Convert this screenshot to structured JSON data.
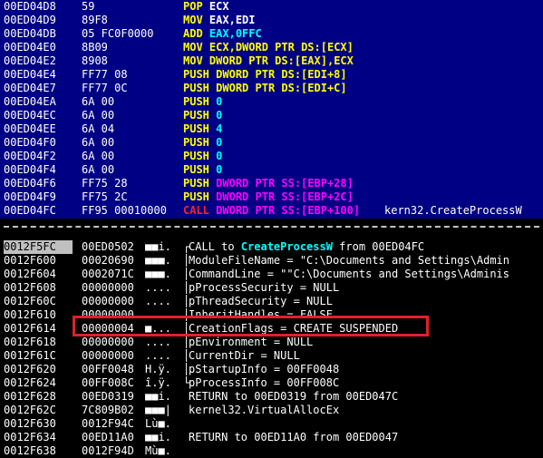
{
  "disasm": {
    "rows": [
      {
        "addr": "00ED04D8",
        "hex": "59",
        "op": "POP",
        "op_color": "yellow",
        "args": "ECX",
        "args_color": "white",
        "comment": ""
      },
      {
        "addr": "00ED04D9",
        "hex": "89F8",
        "op": "MOV",
        "op_color": "yellow",
        "args": "EAX,EDI",
        "args_color": "white",
        "comment": ""
      },
      {
        "addr": "00ED04DB",
        "hex": "05 FC0F0000",
        "op": "ADD",
        "op_color": "yellow",
        "args": "EAX,0FFC",
        "args_color": "cyan",
        "comment": ""
      },
      {
        "addr": "00ED04E0",
        "hex": "8B09",
        "op": "MOV",
        "op_color": "yellow",
        "args": "ECX,DWORD PTR DS:[ECX]",
        "args_color": "yellow",
        "comment": ""
      },
      {
        "addr": "00ED04E2",
        "hex": "8908",
        "op": "MOV",
        "op_color": "yellow",
        "args": "DWORD PTR DS:[EAX],ECX",
        "args_color": "yellow",
        "comment": ""
      },
      {
        "addr": "00ED04E4",
        "hex": "FF77 08",
        "op": "PUSH",
        "op_color": "yellow",
        "args": "DWORD PTR DS:[EDI+8]",
        "args_color": "yellow",
        "comment": ""
      },
      {
        "addr": "00ED04E7",
        "hex": "FF77 0C",
        "op": "PUSH",
        "op_color": "yellow",
        "args": "DWORD PTR DS:[EDI+C]",
        "args_color": "yellow",
        "comment": ""
      },
      {
        "addr": "00ED04EA",
        "hex": "6A 00",
        "op": "PUSH",
        "op_color": "yellow",
        "args": "0",
        "args_color": "cyan",
        "comment": ""
      },
      {
        "addr": "00ED04EC",
        "hex": "6A 00",
        "op": "PUSH",
        "op_color": "yellow",
        "args": "0",
        "args_color": "cyan",
        "comment": ""
      },
      {
        "addr": "00ED04EE",
        "hex": "6A 04",
        "op": "PUSH",
        "op_color": "yellow",
        "args": "4",
        "args_color": "cyan",
        "comment": ""
      },
      {
        "addr": "00ED04F0",
        "hex": "6A 00",
        "op": "PUSH",
        "op_color": "yellow",
        "args": "0",
        "args_color": "cyan",
        "comment": ""
      },
      {
        "addr": "00ED04F2",
        "hex": "6A 00",
        "op": "PUSH",
        "op_color": "yellow",
        "args": "0",
        "args_color": "cyan",
        "comment": ""
      },
      {
        "addr": "00ED04F4",
        "hex": "6A 00",
        "op": "PUSH",
        "op_color": "yellow",
        "args": "0",
        "args_color": "cyan",
        "comment": ""
      },
      {
        "addr": "00ED04F6",
        "hex": "FF75 28",
        "op": "PUSH",
        "op_color": "yellow",
        "args": "DWORD PTR SS:[EBP+28]",
        "args_color": "magenta",
        "comment": ""
      },
      {
        "addr": "00ED04F9",
        "hex": "FF75 2C",
        "op": "PUSH",
        "op_color": "yellow",
        "args": "DWORD PTR SS:[EBP+2C]",
        "args_color": "magenta",
        "comment": ""
      },
      {
        "addr": "00ED04FC",
        "hex": "FF95 00010000",
        "op": "CALL",
        "op_color": "red",
        "args": "DWORD PTR SS:[EBP+100]",
        "args_color": "magenta",
        "comment": "kern32.CreateProcessW"
      }
    ]
  },
  "stack": {
    "rows": [
      {
        "addr": "0012F5FC",
        "val": "00ED0502",
        "ascii": "■■i.",
        "br": "┌",
        "text": "CALL to ",
        "link": "CreateProcessW",
        "tail": " from 00ED04FC",
        "selected": true
      },
      {
        "addr": "0012F600",
        "val": "00020690",
        "ascii": "■■■.",
        "br": "│",
        "text": "ModuleFileName = \"C:\\Documents and Settings\\Admin",
        "link": "",
        "tail": "",
        "selected": false
      },
      {
        "addr": "0012F604",
        "val": "0002071C",
        "ascii": "■■■.",
        "br": "│",
        "text": "CommandLine = \"\"C:\\Documents and Settings\\Adminis",
        "link": "",
        "tail": "",
        "selected": false
      },
      {
        "addr": "0012F608",
        "val": "00000000",
        "ascii": "....",
        "br": "│",
        "text": "pProcessSecurity = NULL",
        "link": "",
        "tail": "",
        "selected": false
      },
      {
        "addr": "0012F60C",
        "val": "00000000",
        "ascii": "....",
        "br": "│",
        "text": "pThreadSecurity = NULL",
        "link": "",
        "tail": "",
        "selected": false
      },
      {
        "addr": "0012F610",
        "val": "00000000",
        "ascii": "....",
        "br": "│",
        "text": "InheritHandles = FALSE",
        "link": "",
        "tail": "",
        "selected": false
      },
      {
        "addr": "0012F614",
        "val": "00000004",
        "ascii": "■...",
        "br": "│",
        "text": "CreationFlags = CREATE_SUSPENDED",
        "link": "",
        "tail": "",
        "selected": false
      },
      {
        "addr": "0012F618",
        "val": "00000000",
        "ascii": "....",
        "br": "│",
        "text": "pEnvironment = NULL",
        "link": "",
        "tail": "",
        "selected": false
      },
      {
        "addr": "0012F61C",
        "val": "00000000",
        "ascii": "....",
        "br": "│",
        "text": "CurrentDir = NULL",
        "link": "",
        "tail": "",
        "selected": false
      },
      {
        "addr": "0012F620",
        "val": "00FF0048",
        "ascii": "H.ÿ.",
        "br": "│",
        "text": "pStartupInfo = 00FF0048",
        "link": "",
        "tail": "",
        "selected": false
      },
      {
        "addr": "0012F624",
        "val": "00FF008C",
        "ascii": "î.ÿ.",
        "br": "└",
        "text": "pProcessInfo = 00FF008C",
        "link": "",
        "tail": "",
        "selected": false
      },
      {
        "addr": "0012F628",
        "val": "00ED0319",
        "ascii": "■■i.",
        "br": "",
        "text": "RETURN to 00ED0319 from 00ED047C",
        "link": "",
        "tail": "",
        "selected": false
      },
      {
        "addr": "0012F62C",
        "val": "7C809B02",
        "ascii": "■■■|",
        "br": "",
        "text": "kernel32.VirtualAllocEx",
        "link": "",
        "tail": "",
        "selected": false
      },
      {
        "addr": "0012F630",
        "val": "0012F94C",
        "ascii": "Lù■.",
        "br": "",
        "text": "",
        "link": "",
        "tail": "",
        "selected": false
      },
      {
        "addr": "0012F634",
        "val": "00ED11A0",
        "ascii": "■■i.",
        "br": "",
        "text": "RETURN to 00ED11A0 from 00ED0047",
        "link": "",
        "tail": "",
        "selected": false
      },
      {
        "addr": "0012F638",
        "val": "0012F94D",
        "ascii": "Mù■.",
        "br": "",
        "text": "",
        "link": "",
        "tail": "",
        "selected": false
      }
    ],
    "highlighted_row": "0012F614"
  },
  "colors": {
    "disasm_bg": "#000084",
    "highlight_border": "#e0202a"
  }
}
